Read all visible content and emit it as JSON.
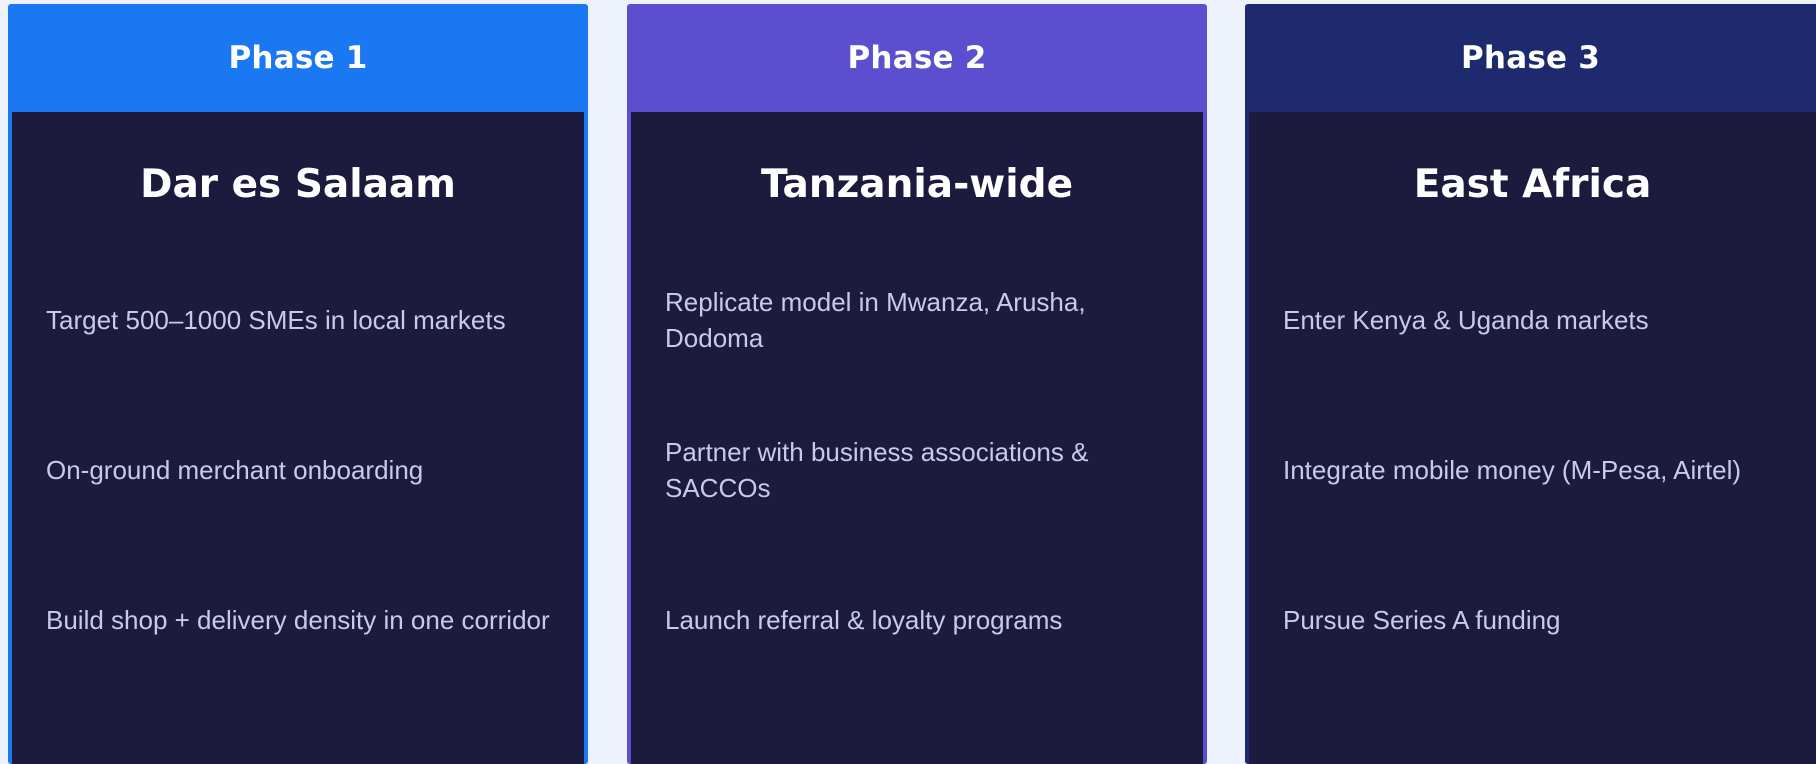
{
  "colors": {
    "page_background": "#eef2fc",
    "card_body": "#1c1b3e",
    "phase1_accent": "#1a78f2",
    "phase2_accent": "#5b4fcf",
    "phase3_accent": "#1d2a6e",
    "heading_text": "#ffffff",
    "bullet_text": "#c5cbe8"
  },
  "phases": [
    {
      "label": "Phase 1",
      "region": "Dar es Salaam",
      "items": [
        "Target 500–1000 SMEs in local markets",
        "On-ground merchant onboarding",
        "Build shop + delivery density in one corridor"
      ]
    },
    {
      "label": "Phase 2",
      "region": "Tanzania-wide",
      "items": [
        "Replicate model in Mwanza, Arusha, Dodoma",
        "Partner with business associations & SACCOs",
        "Launch referral & loyalty programs"
      ]
    },
    {
      "label": "Phase 3",
      "region": "East Africa",
      "items": [
        "Enter Kenya & Uganda markets",
        "Integrate mobile money (M-Pesa, Airtel)",
        "Pursue Series A funding"
      ]
    }
  ]
}
